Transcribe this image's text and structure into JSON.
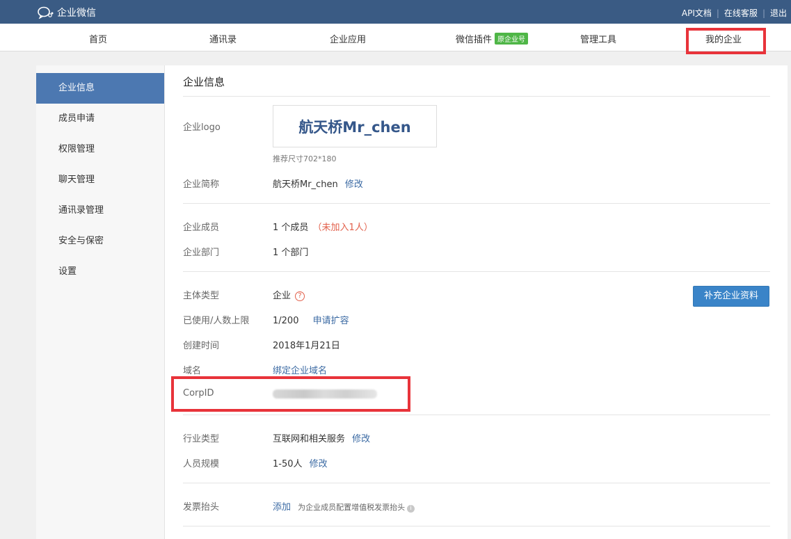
{
  "brand": {
    "name": "企业微信"
  },
  "toplinks": {
    "api": "API文档",
    "sep": "|",
    "service": "在线客服",
    "logout": "退出"
  },
  "nav": {
    "home": "首页",
    "contacts": "通讯录",
    "apps": "企业应用",
    "plugin": "微信插件",
    "plugin_badge": "原企业号",
    "tools": "管理工具",
    "my_company": "我的企业"
  },
  "sidebar": {
    "items": [
      {
        "label": "企业信息",
        "active": true
      },
      {
        "label": "成员申请"
      },
      {
        "label": "权限管理"
      },
      {
        "label": "聊天管理"
      },
      {
        "label": "通讯录管理"
      },
      {
        "label": "安全与保密"
      },
      {
        "label": "设置"
      }
    ]
  },
  "info": {
    "title": "企业信息",
    "logo_label": "企业logo",
    "logo_text": "航天桥Mr_chen",
    "logo_hint": "推荐尺寸702*180",
    "short_name_label": "企业简称",
    "short_name": "航天桥Mr_chen",
    "edit": "修改",
    "members_label": "企业成员",
    "members_value": "1 个成员",
    "members_note": "（未加入1人）",
    "depts_label": "企业部门",
    "depts_value": "1 个部门",
    "type_label": "主体类型",
    "type_value": "企业",
    "type_help": "?",
    "supplement_button": "补充企业资料",
    "usage_label": "已使用/人数上限",
    "usage_value": "1/200",
    "expand_link": "申请扩容",
    "created_label": "创建时间",
    "created_value": "2018年1月21日",
    "domain_label": "域名",
    "domain_link": "绑定企业域名",
    "corpid_label": "CorpID",
    "industry_label": "行业类型",
    "industry_value": "互联网和相关服务",
    "scale_label": "人员规模",
    "scale_value": "1-50人",
    "invoice_label": "发票抬头",
    "invoice_add": "添加",
    "invoice_hint": "为企业成员配置增值税发票抬头",
    "invoice_info": "i"
  },
  "colors": {
    "topbar": "#3a5b84",
    "accent": "#4c78b1",
    "link": "#3b6aa3",
    "alert": "#e2604b",
    "badge": "#4fb647",
    "highlight": "#e8333a"
  }
}
